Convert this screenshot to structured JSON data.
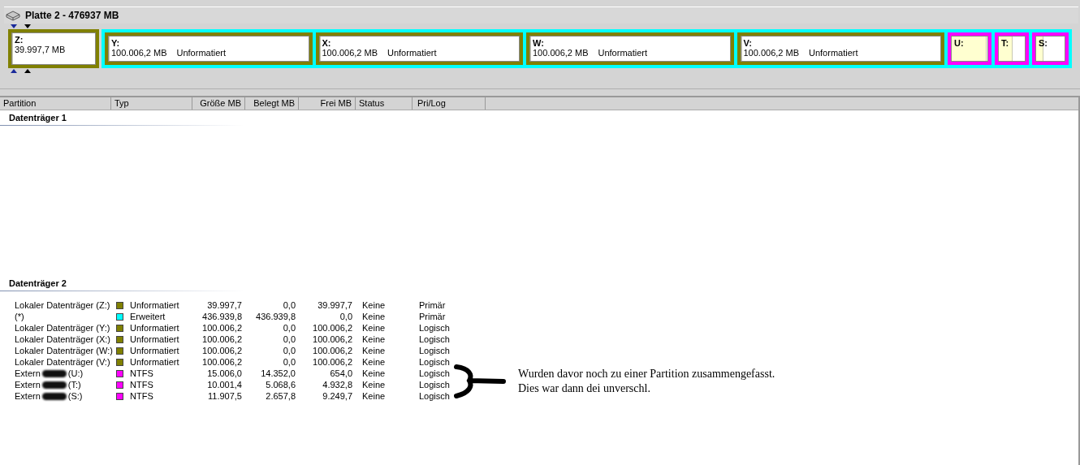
{
  "disk_map": {
    "title": "Platte 2 - 476937 MB",
    "segments": [
      {
        "kind": "primary",
        "letter": "Z:",
        "size": "39.997,7 MB",
        "level": 0
      },
      {
        "kind": "extended",
        "children": [
          {
            "kind": "logical",
            "letter": "Y:",
            "size": "100.006,2 MB",
            "type": "Unformatiert",
            "level": 0
          },
          {
            "kind": "logical",
            "letter": "X:",
            "size": "100.006,2 MB",
            "type": "Unformatiert",
            "level": 0
          },
          {
            "kind": "logical",
            "letter": "W:",
            "size": "100.006,2 MB",
            "type": "Unformatiert",
            "level": 0
          },
          {
            "kind": "logical",
            "letter": "V:",
            "size": "100.006,2 MB",
            "type": "Unformatiert",
            "level": 0
          },
          {
            "kind": "ntfs",
            "letter": "U:",
            "level": 0.96
          },
          {
            "kind": "ntfs",
            "letter": "T:",
            "level": 0.5
          },
          {
            "kind": "ntfs",
            "letter": "S:",
            "level": 0.22
          }
        ]
      }
    ]
  },
  "table": {
    "columns": [
      "Partition",
      "Typ",
      "Größe MB",
      "Belegt MB",
      "Frei MB",
      "Status",
      "Pri/Log"
    ],
    "groups": [
      {
        "title": "Datenträger 1"
      },
      {
        "title": "Datenträger 2",
        "rows": [
          {
            "name": "Lokaler Datenträger (Z:)",
            "color": "#808000",
            "type": "Unformatiert",
            "size": "39.997,7",
            "used": "0,0",
            "free": "39.997,7",
            "status": "Keine",
            "prilog": "Primär"
          },
          {
            "name": "(*)",
            "color": "#00ffff",
            "type": "Erweitert",
            "size": "436.939,8",
            "used": "436.939,8",
            "free": "0,0",
            "status": "Keine",
            "prilog": "Primär"
          },
          {
            "name": "Lokaler Datenträger (Y:)",
            "color": "#808000",
            "type": "Unformatiert",
            "size": "100.006,2",
            "used": "0,0",
            "free": "100.006,2",
            "status": "Keine",
            "prilog": "Logisch"
          },
          {
            "name": "Lokaler Datenträger (X:)",
            "color": "#808000",
            "type": "Unformatiert",
            "size": "100.006,2",
            "used": "0,0",
            "free": "100.006,2",
            "status": "Keine",
            "prilog": "Logisch"
          },
          {
            "name": "Lokaler Datenträger (W:)",
            "color": "#808000",
            "type": "Unformatiert",
            "size": "100.006,2",
            "used": "0,0",
            "free": "100.006,2",
            "status": "Keine",
            "prilog": "Logisch"
          },
          {
            "name": "Lokaler Datenträger (V:)",
            "color": "#808000",
            "type": "Unformatiert",
            "size": "100.006,2",
            "used": "0,0",
            "free": "100.006,2",
            "status": "Keine",
            "prilog": "Logisch"
          },
          {
            "name": "Extern",
            "suffix": "(U:)",
            "color": "#ff00ff",
            "type": "NTFS",
            "size": "15.006,0",
            "used": "14.352,0",
            "free": "654,0",
            "status": "Keine",
            "prilog": "Logisch"
          },
          {
            "name": "Extern",
            "suffix": "(T:)",
            "color": "#ff00ff",
            "type": "NTFS",
            "size": "10.001,4",
            "used": "5.068,6",
            "free": "4.932,8",
            "status": "Keine",
            "prilog": "Logisch"
          },
          {
            "name": "Extern",
            "suffix": "(S:)",
            "color": "#ff00ff",
            "type": "NTFS",
            "size": "11.907,5",
            "used": "2.657,8",
            "free": "9.249,7",
            "status": "Keine",
            "prilog": "Logisch"
          }
        ]
      }
    ]
  },
  "note": [
    "Wurden davor noch zu einer Partition zusammengefasst.",
    "Dies war dann dei unverschl."
  ]
}
